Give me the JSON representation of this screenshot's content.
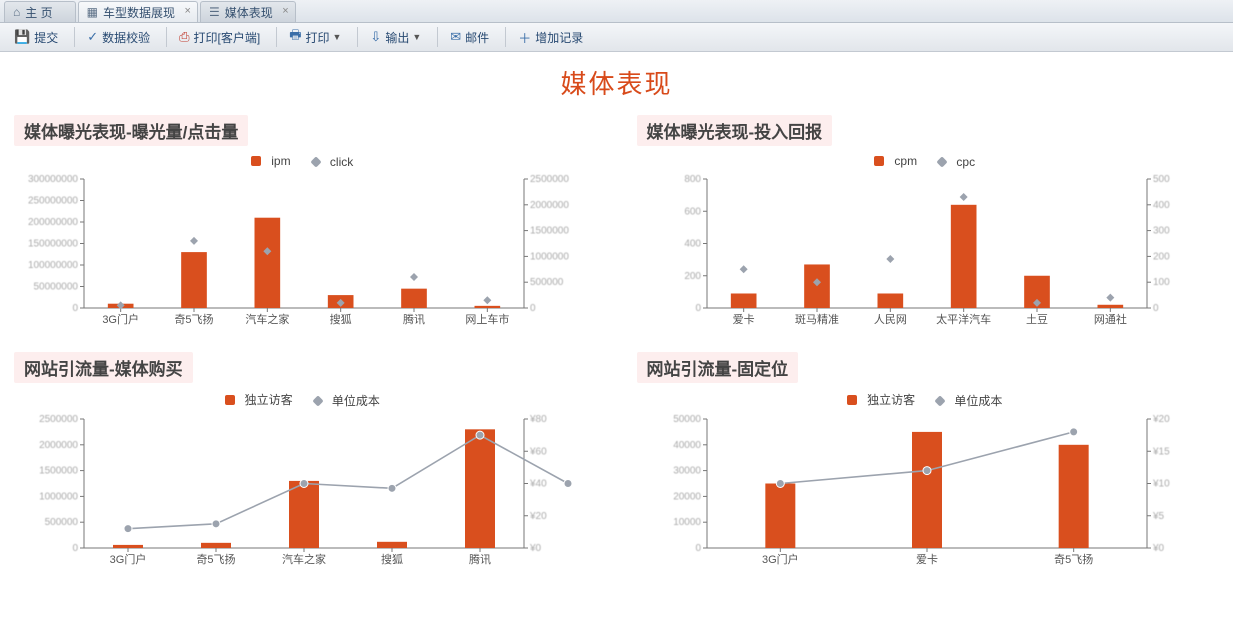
{
  "tabs": {
    "home": {
      "label": "主    页"
    },
    "data": {
      "label": "车型数据展现"
    },
    "media": {
      "label": "媒体表现"
    }
  },
  "toolbar": {
    "submit": "提交",
    "validate": "数据校验",
    "print_client": "打印[客户端]",
    "print": "打印",
    "export": "输出",
    "mail": "邮件",
    "addrec": "增加记录"
  },
  "page_title": "媒体表现",
  "charts": {
    "c1": {
      "title": "媒体曝光表现-曝光量/点击量",
      "legend_bar": "ipm",
      "legend_pt": "click"
    },
    "c2": {
      "title": "媒体曝光表现-投入回报",
      "legend_bar": "cpm",
      "legend_pt": "cpc"
    },
    "c3": {
      "title": "网站引流量-媒体购买",
      "legend_bar": "独立访客",
      "legend_pt": "单位成本"
    },
    "c4": {
      "title": "网站引流量-固定位",
      "legend_bar": "独立访客",
      "legend_pt": "单位成本"
    }
  },
  "chart_data": [
    {
      "id": "c1",
      "type": "bar+scatter",
      "categories": [
        "3G门户",
        "奇5飞扬",
        "汽车之家",
        "搜狐",
        "腾讯",
        "网上车市"
      ],
      "bar": {
        "name": "ipm",
        "axis": "left",
        "values": [
          10000000,
          130000000,
          210000000,
          30000000,
          45000000,
          5000000
        ]
      },
      "scatter": {
        "name": "click",
        "axis": "right",
        "values": [
          50000,
          1300000,
          1100000,
          100000,
          600000,
          150000
        ]
      },
      "yleft": {
        "min": 0,
        "max": 300000000,
        "step": 50000000,
        "ticks": [
          0,
          50000000,
          100000000,
          150000000,
          200000000,
          250000000,
          300000000
        ],
        "ticklabels": [
          "0",
          "50000000",
          "100000000",
          "150000000",
          "200000000",
          "250000000",
          "300000000"
        ]
      },
      "yright": {
        "min": 0,
        "max": 2500000,
        "step": 500000,
        "ticks": [
          0,
          500000,
          1000000,
          1500000,
          2000000,
          2500000
        ],
        "ticklabels": [
          "0",
          "500000",
          "1000000",
          "1500000",
          "2000000",
          "2500000"
        ]
      }
    },
    {
      "id": "c2",
      "type": "bar+scatter",
      "categories": [
        "爱卡",
        "斑马精准",
        "人民网",
        "太平洋汽车",
        "土豆",
        "网通社"
      ],
      "bar": {
        "name": "cpm",
        "axis": "left",
        "values": [
          90,
          270,
          90,
          640,
          200,
          20
        ]
      },
      "scatter": {
        "name": "cpc",
        "axis": "right",
        "values": [
          150,
          100,
          190,
          430,
          20,
          40
        ]
      },
      "yleft": {
        "min": 0,
        "max": 800,
        "step": 200,
        "ticks": [
          0,
          200,
          400,
          600,
          800
        ],
        "ticklabels": [
          "0",
          "200",
          "400",
          "600",
          "800"
        ]
      },
      "yright": {
        "min": 0,
        "max": 500,
        "step": 100,
        "ticks": [
          0,
          100,
          200,
          300,
          400,
          500
        ],
        "ticklabels": [
          "0",
          "100",
          "200",
          "300",
          "400",
          "500"
        ]
      }
    },
    {
      "id": "c3",
      "type": "bar+line",
      "categories": [
        "3G门户",
        "奇5飞扬",
        "汽车之家",
        "搜狐",
        "腾讯"
      ],
      "bar": {
        "name": "独立访客",
        "axis": "left",
        "values": [
          60000,
          100000,
          1300000,
          120000,
          2300000
        ]
      },
      "line": {
        "name": "单位成本",
        "axis": "right",
        "values": [
          12,
          15,
          40,
          37,
          70
        ],
        "extra_trailing": [
          40
        ]
      },
      "yleft": {
        "min": 0,
        "max": 2500000,
        "step": 500000,
        "ticks": [
          0,
          500000,
          1000000,
          1500000,
          2000000,
          2500000
        ],
        "ticklabels": [
          "0",
          "500000",
          "1000000",
          "1500000",
          "2000000",
          "2500000"
        ]
      },
      "yright": {
        "min": 0,
        "max": 80,
        "step": 20,
        "prefix": "¥",
        "ticks": [
          0,
          20,
          40,
          60,
          80
        ],
        "ticklabels": [
          "¥0",
          "¥20",
          "¥40",
          "¥60",
          "¥80"
        ]
      }
    },
    {
      "id": "c4",
      "type": "bar+line",
      "categories": [
        "3G门户",
        "爱卡",
        "奇5飞扬"
      ],
      "bar": {
        "name": "独立访客",
        "axis": "left",
        "values": [
          25000,
          45000,
          40000
        ]
      },
      "line": {
        "name": "单位成本",
        "axis": "right",
        "values": [
          10,
          12,
          18
        ]
      },
      "yleft": {
        "min": 0,
        "max": 50000,
        "step": 10000,
        "ticks": [
          0,
          10000,
          20000,
          30000,
          40000,
          50000
        ],
        "ticklabels": [
          "0",
          "10000",
          "20000",
          "30000",
          "40000",
          "50000"
        ]
      },
      "yright": {
        "min": 0,
        "max": 20,
        "step": 5,
        "prefix": "¥",
        "ticks": [
          0,
          5,
          10,
          15,
          20
        ],
        "ticklabels": [
          "¥0",
          "¥5",
          "¥10",
          "¥15",
          "¥20"
        ]
      }
    }
  ]
}
